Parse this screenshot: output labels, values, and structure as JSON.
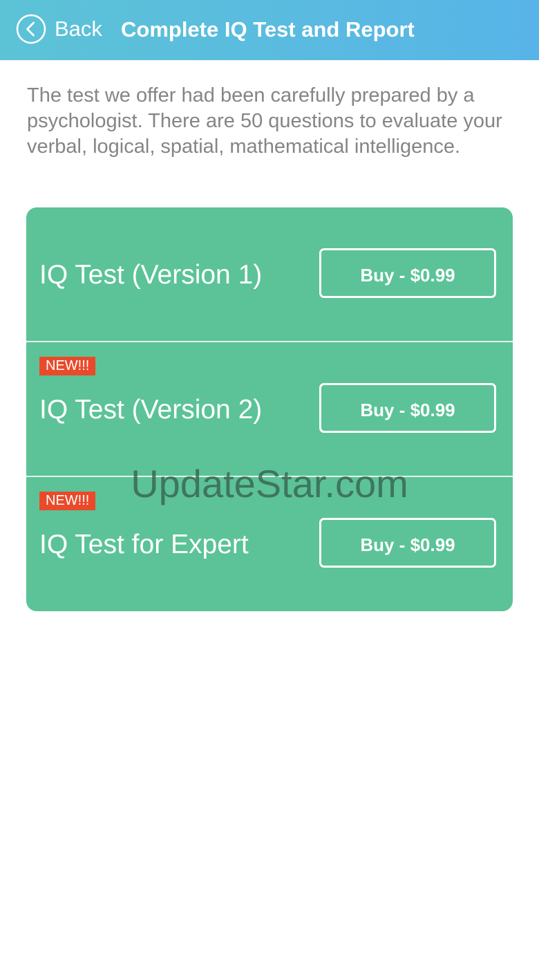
{
  "nav": {
    "back_label": "Back",
    "title": "Complete IQ Test and Report"
  },
  "intro": "The test we offer had been carefully prepared by a psychologist. There are 50 questions to evaluate your verbal, logical, spatial, mathematical intelligence.",
  "products": [
    {
      "title": "IQ Test (Version 1)",
      "badge": "",
      "buy_label": "Buy - $0.99"
    },
    {
      "title": "IQ Test (Version 2)",
      "badge": "NEW!!!",
      "buy_label": "Buy - $0.99"
    },
    {
      "title": "IQ Test for Expert",
      "badge": "NEW!!!",
      "buy_label": "Buy - $0.99"
    }
  ],
  "watermark": "UpdateStar.com",
  "icons": {
    "back": "chevron-left-circle-icon"
  },
  "colors": {
    "navbar_start": "#5cc3d6",
    "navbar_end": "#58b4e8",
    "card": "#5bc397",
    "badge": "#ea4a2a",
    "intro_text": "#858585"
  }
}
